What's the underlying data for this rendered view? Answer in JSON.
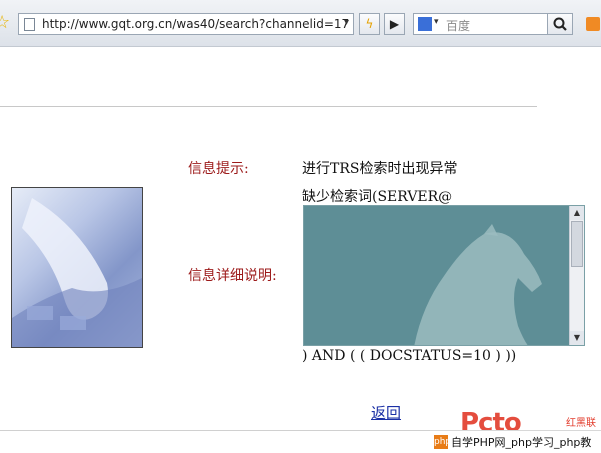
{
  "browser": {
    "url": "http://www.gqt.org.cn/was40/search?channelid=17",
    "search_placeholder": "百度",
    "colors": {
      "rss": "#f08a24",
      "engine": "#3a6fd8"
    }
  },
  "error": {
    "info_label": "信息提示:",
    "info_value": "进行TRS检索时出现异常",
    "detail_line1": "缺少检索词(SERVER@",
    "detail_label": "信息详细说明:",
    "detail_line2": ") AND ( ( DOCSTATUS=10 ) ))",
    "back_link": "返回"
  },
  "watermark": {
    "logo": "Pcto",
    "sub": "红黑联盟",
    "badge": "php",
    "text": "自学PHP网_php学习_php教"
  }
}
